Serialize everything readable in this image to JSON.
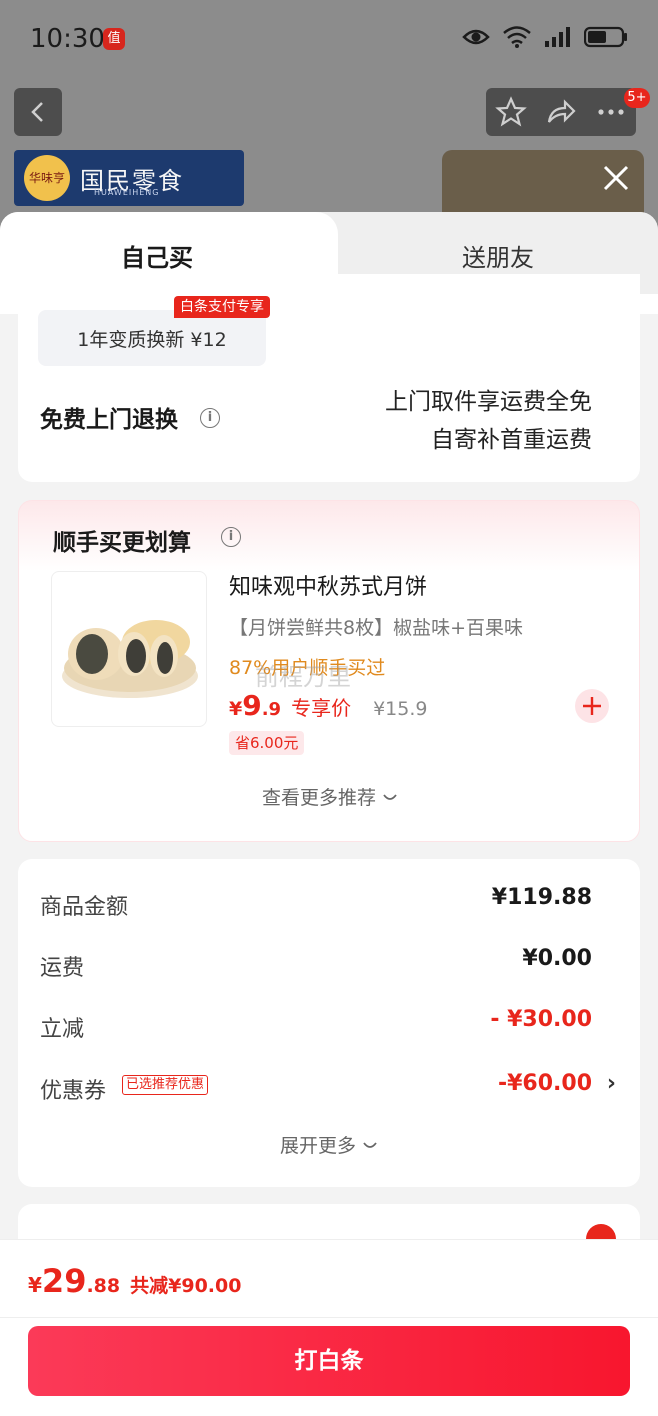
{
  "status_bar": {
    "time": "10:30",
    "app_badge": "值"
  },
  "header": {
    "badge_count": "5+",
    "banner_brand": "国民零食",
    "banner_sub": "HUAWEIHENG",
    "banner_logo": "华味亨"
  },
  "tabs": [
    {
      "label": "自己买",
      "active": true
    },
    {
      "label": "送朋友",
      "active": false
    }
  ],
  "return_service": {
    "option_label": "1年变质换新  ¥12",
    "option_tag": "白条支付专享",
    "title": "免费上门退换",
    "line1": "上门取件享运费全免",
    "line2": "自寄补首重运费"
  },
  "addon": {
    "title": "顺手买更划算",
    "product": {
      "name": "知味观中秋苏式月饼",
      "spec": "【月饼尝鲜共8枚】椒盐味+百果味",
      "social": "87%用户顺手买过",
      "price_symbol": "¥",
      "price_int": "9",
      "price_dec": ".9",
      "price_tag": "专享价",
      "price_old": "¥15.9",
      "save": "省6.00元"
    },
    "watermark": "前程万里",
    "more": "查看更多推荐"
  },
  "price_detail": {
    "rows": [
      {
        "label": "商品金额",
        "value": "¥119.88",
        "red": false
      },
      {
        "label": "运费",
        "value": "¥0.00",
        "red": false
      },
      {
        "label": "立减",
        "value": "- ¥30.00",
        "red": true
      },
      {
        "label": "优惠券",
        "value": "-¥60.00",
        "red": true
      }
    ],
    "coupon_tag": "已选推荐优惠",
    "expand": "展开更多"
  },
  "bottom": {
    "total_symbol": "¥",
    "total_int": "29",
    "total_dec": ".88",
    "total_discount": "共减¥90.00",
    "pay_button": "打白条"
  },
  "colors": {
    "accent_red": "#e8261c",
    "social_orange": "#e08a1e"
  },
  "icons": [
    "back-icon",
    "star-icon",
    "share-icon",
    "more-icon",
    "close-icon",
    "info-icon",
    "plus-icon",
    "chevron-down-icon",
    "chevron-right-icon",
    "eye-icon",
    "wifi-icon",
    "signal-icon",
    "battery-icon"
  ]
}
